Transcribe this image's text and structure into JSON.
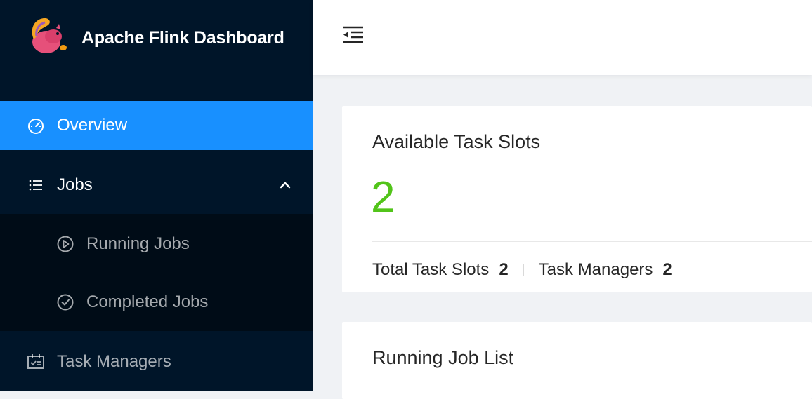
{
  "app": {
    "title": "Apache Flink Dashboard"
  },
  "sidebar": {
    "items": [
      {
        "label": "Overview",
        "icon": "dashboard-icon",
        "selected": true
      },
      {
        "label": "Jobs",
        "icon": "list-icon",
        "expanded": true,
        "children": [
          {
            "label": "Running Jobs",
            "icon": "play-circle-icon"
          },
          {
            "label": "Completed Jobs",
            "icon": "check-circle-icon"
          }
        ]
      },
      {
        "label": "Task Managers",
        "icon": "schedule-icon"
      }
    ]
  },
  "header": {
    "menu_fold_icon": "menu-fold-icon"
  },
  "overview": {
    "slots_card": {
      "title": "Available Task Slots",
      "available": "2",
      "total_label": "Total Task Slots",
      "total_value": "2",
      "managers_label": "Task Managers",
      "managers_value": "2"
    },
    "jobs_card": {
      "title": "Running Job List"
    }
  },
  "colors": {
    "sidebar_bg": "#001529",
    "submenu_bg": "#000c17",
    "selected_bg": "#1890ff",
    "available_number": "#52c41a"
  }
}
